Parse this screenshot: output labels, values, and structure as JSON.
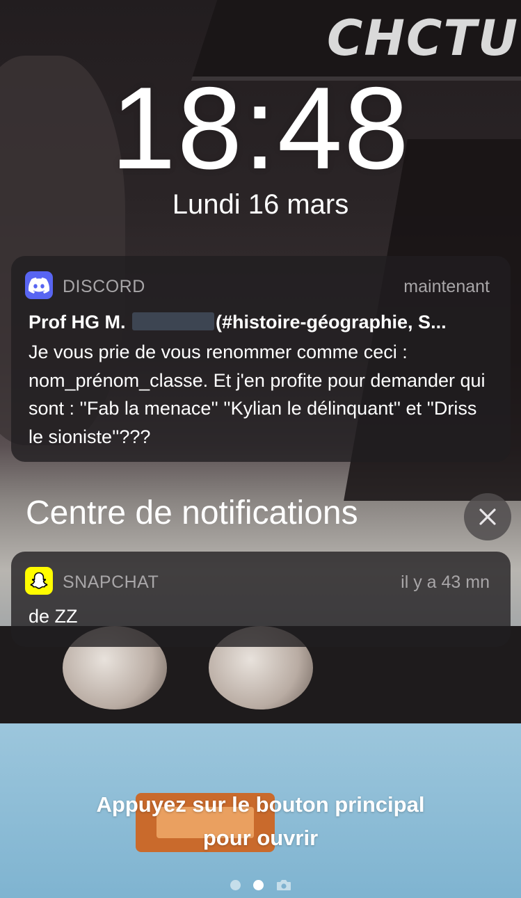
{
  "lockscreen": {
    "time": "18:48",
    "date": "Lundi 16 mars"
  },
  "notifications": [
    {
      "app": "DISCORD",
      "icon": "discord-icon",
      "accent": "#5865F2",
      "time": "maintenant",
      "title_prefix": "Prof HG M.",
      "title_suffix": "(#histoire-géographie, S...",
      "body": "Je vous prie de vous renommer comme ceci : nom_prénom_classe. Et j'en profite pour demander qui sont : ''Fab la menace'' ''Kylian le délinquant'' et ''Driss le sioniste''???"
    }
  ],
  "notification_center": {
    "title": "Centre de notifications",
    "close_icon": "close-icon",
    "items": [
      {
        "app": "SNAPCHAT",
        "icon": "snapchat-ghost-icon",
        "accent": "#FFFC00",
        "time": "il y a 43 mn",
        "body": "de ZZ"
      }
    ]
  },
  "hint": {
    "line1": "Appuyez sur le bouton principal",
    "line2": "pour ouvrir"
  },
  "pager": {
    "dots": 2,
    "active_index": 1,
    "camera_icon": "camera-icon"
  }
}
